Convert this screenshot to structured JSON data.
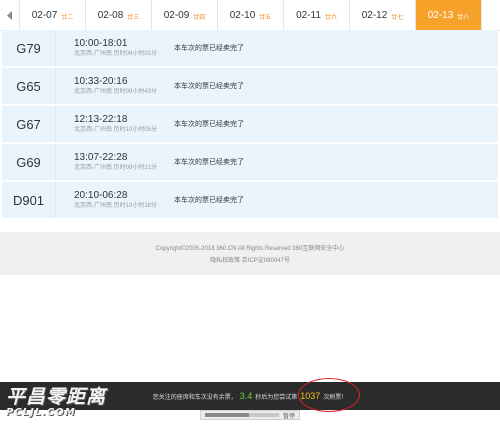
{
  "date_tabs": [
    {
      "date": "02-07",
      "lunar": "廿二",
      "active": false
    },
    {
      "date": "02-08",
      "lunar": "廿三",
      "active": false
    },
    {
      "date": "02-09",
      "lunar": "廿四",
      "active": false
    },
    {
      "date": "02-10",
      "lunar": "廿五",
      "active": false
    },
    {
      "date": "02-11",
      "lunar": "廿六",
      "active": false
    },
    {
      "date": "02-12",
      "lunar": "廿七",
      "active": false
    },
    {
      "date": "02-13",
      "lunar": "廿八",
      "active": true
    }
  ],
  "trains": [
    {
      "no": "G79",
      "time": "10:00-18:01",
      "route": "北京西-广州南",
      "duration": "历时08小时01分",
      "status": "本车次的票已经卖完了"
    },
    {
      "no": "G65",
      "time": "10:33-20:16",
      "route": "北京西-广州南",
      "duration": "历时09小时43分",
      "status": "本车次的票已经卖完了"
    },
    {
      "no": "G67",
      "time": "12:13-22:18",
      "route": "北京西-广州南",
      "duration": "历时10小时05分",
      "status": "本车次的票已经卖完了"
    },
    {
      "no": "G69",
      "time": "13:07-22:28",
      "route": "北京西-广州南",
      "duration": "历时09小时21分",
      "status": "本车次的票已经卖完了"
    },
    {
      "no": "D901",
      "time": "20:10-06:28",
      "route": "北京西-广州南",
      "duration": "历时10小时18分",
      "status": "本车次的票已经卖完了"
    }
  ],
  "footer": {
    "copyright": "Copyright©2005-2018 360.CN All Rights Reserved 360互联网安全中心",
    "links": "隐私权政策 京ICP证080047号"
  },
  "notice": {
    "text_before": "您关注的座席和车次没有余票，",
    "seconds": "3.4",
    "text_middle": "秒后为您尝试第",
    "attempt": "1037",
    "text_after": "次刷票！",
    "pause_label": "暂停",
    "progress": 0.6
  },
  "watermark": {
    "cn": "平昌零距离",
    "en": "PCLJL.COM"
  },
  "colors": {
    "active_tab": "#f7a32b",
    "row_bg": "#eaf4fc",
    "notice_bg": "#2b2b2b",
    "seconds": "#6ccf3a",
    "attempt": "#f2c21b",
    "circle": "#e0202a"
  }
}
